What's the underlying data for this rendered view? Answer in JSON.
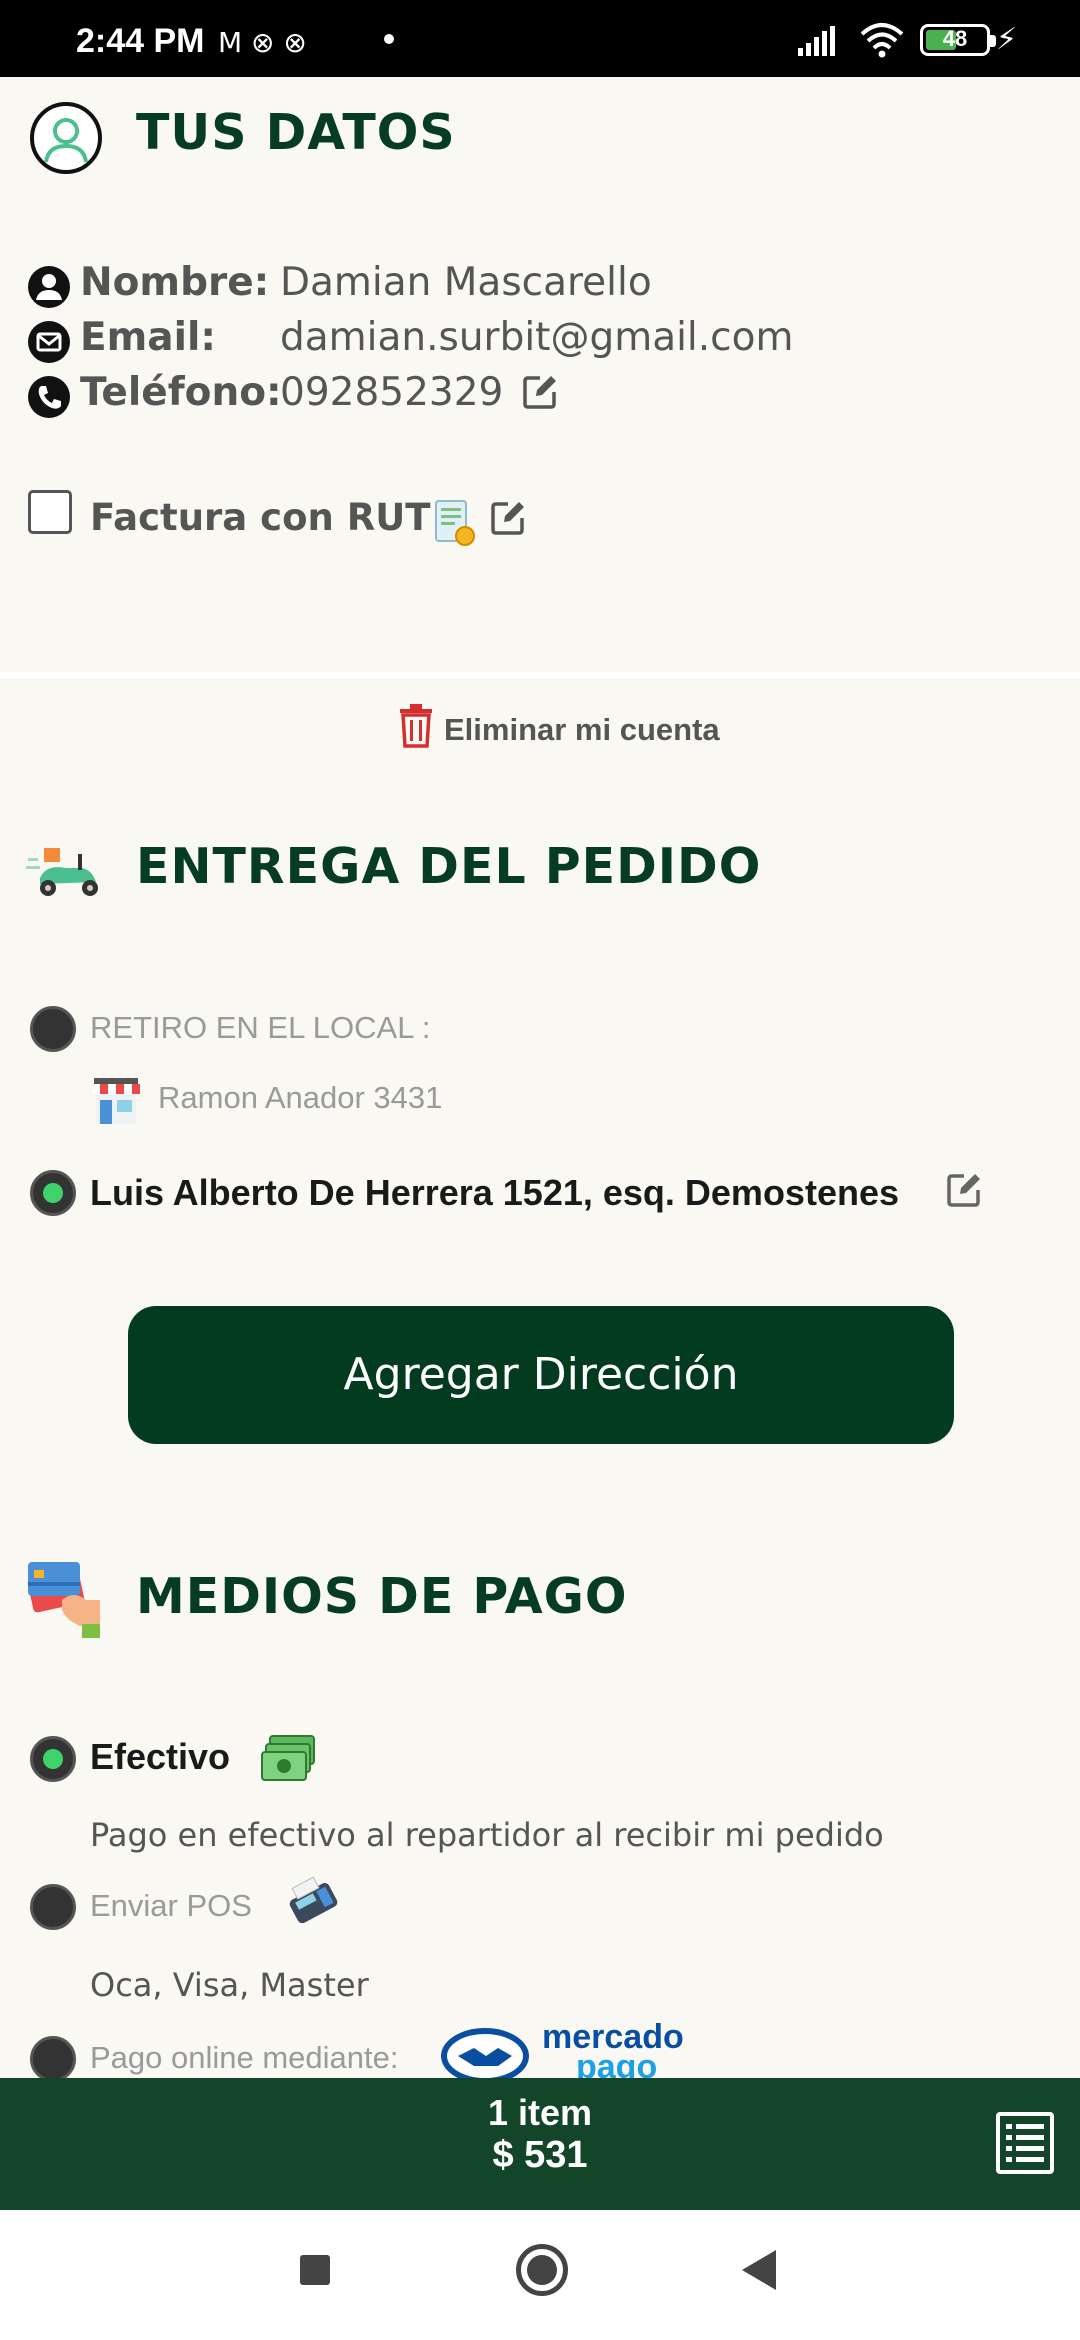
{
  "status_bar": {
    "time": "2:44 PM",
    "notification_icons": "M ⊗ ⊗",
    "battery": "48"
  },
  "datos": {
    "title": "TUS DATOS",
    "nombre_label": "Nombre:",
    "nombre_value": "Damian Mascarello",
    "email_label": "Email:",
    "email_value": "damian.surbit@gmail.com",
    "telefono_label": "Teléfono:",
    "telefono_value": "092852329",
    "factura_label": "Factura con RUT",
    "factura_checked": false
  },
  "delete_account": "Eliminar mi cuenta",
  "entrega": {
    "title": "ENTREGA DEL PEDIDO",
    "retiro_label": "RETIRO EN EL LOCAL :",
    "local_address": "Ramon Anador 3431",
    "selected_address": "Luis Alberto De Herrera 1521, esq. Demostenes",
    "add_button": "Agregar Dirección"
  },
  "pago": {
    "title": "MEDIOS DE PAGO",
    "efectivo_label": "Efectivo",
    "efectivo_desc": "Pago en efectivo al repartidor al recibir mi pedido",
    "pos_label": "Enviar POS",
    "pos_desc": "Oca, Visa, Master",
    "online_label": "Pago online mediante:",
    "mp_line1": "mercado",
    "mp_line2": "pago"
  },
  "cart": {
    "items": "1 item",
    "total": "$ 531"
  },
  "colors": {
    "primary_dark": "#023b1e",
    "cart_bar": "#134629",
    "title_green": "#063d22",
    "radio_selected": "#3fd36b",
    "delete_red": "#d32f2f",
    "background": "#faf8f3"
  }
}
